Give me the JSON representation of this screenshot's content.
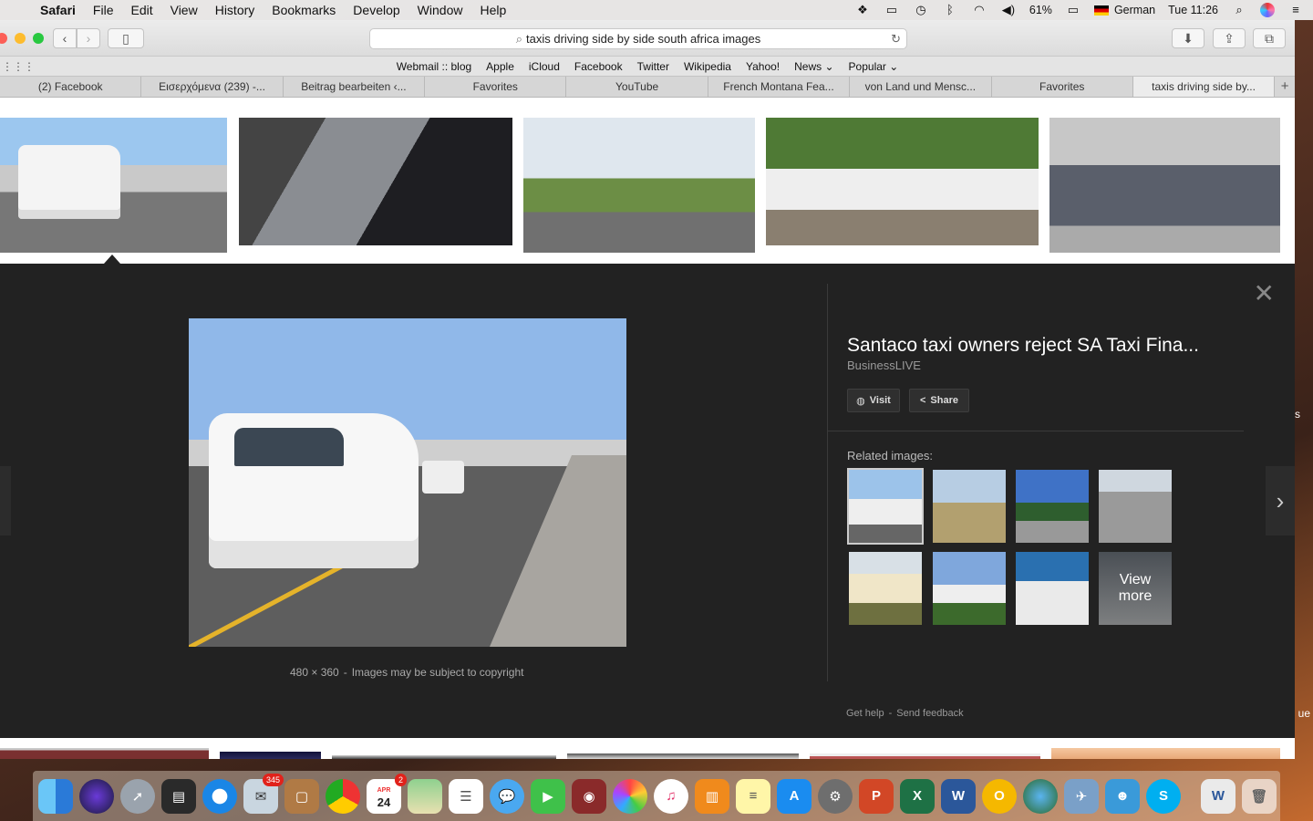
{
  "menubar": {
    "app": "Safari",
    "items": [
      "File",
      "Edit",
      "View",
      "History",
      "Bookmarks",
      "Develop",
      "Window",
      "Help"
    ],
    "battery": "61%",
    "input_source": "German",
    "clock": "Tue 11:26"
  },
  "toolbar": {
    "address": "taxis driving side by side south africa images"
  },
  "favorites": [
    "Webmail :: blog",
    "Apple",
    "iCloud",
    "Facebook",
    "Twitter",
    "Wikipedia",
    "Yahoo!",
    "News ⌄",
    "Popular ⌄"
  ],
  "tabs": [
    {
      "label": "(2) Facebook"
    },
    {
      "label": "Εισερχόμενα (239) -..."
    },
    {
      "label": "Beitrag bearbeiten ‹..."
    },
    {
      "label": "Favorites"
    },
    {
      "label": "YouTube"
    },
    {
      "label": "French Montana Fea..."
    },
    {
      "label": "von Land und Mensc..."
    },
    {
      "label": "Favorites"
    },
    {
      "label": "taxis driving side by..."
    }
  ],
  "preview": {
    "title": "Santaco taxi owners reject SA Taxi Fina...",
    "source": "BusinessLIVE",
    "visit_label": "Visit",
    "share_label": "Share",
    "related_label": "Related images:",
    "view_more_label": "View\nmore",
    "image_size": "480 × 360",
    "copyright": "Images may be subject to copyright",
    "help": "Get help",
    "feedback": "Send feedback"
  },
  "dock": {
    "photos_badge": "345",
    "calendar_month": "APR",
    "calendar_day": "24",
    "calendar_badge": "2"
  },
  "desktop": {
    "text1": "ue",
    "text2": "s"
  }
}
